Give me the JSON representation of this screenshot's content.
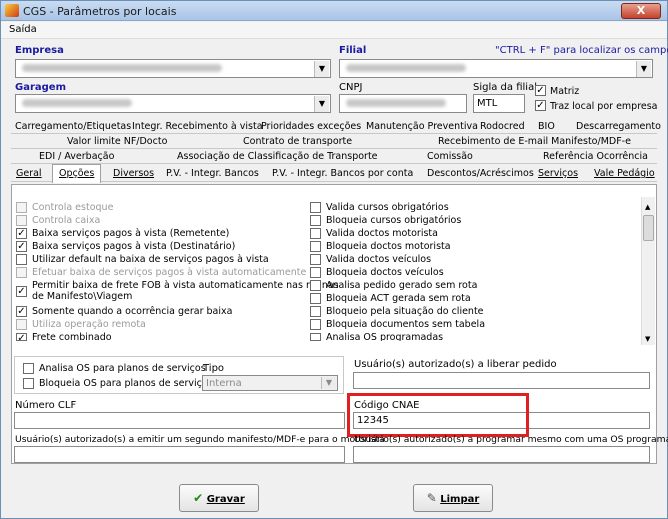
{
  "window": {
    "title": "CGS - Parâmetros por locais",
    "close_label": "X"
  },
  "menu": {
    "saida": "Saída"
  },
  "form": {
    "empresa_label": "Empresa",
    "filial_label": "Filial",
    "hint": "\"CTRL + F\" para localizar os campos",
    "garagem_label": "Garagem",
    "cnpj_label": "CNPJ",
    "sigla_label": "Sigla da filial",
    "sigla_value": "MTL",
    "matriz_label": "Matriz",
    "traz_local_label": "Traz local por empresa"
  },
  "tabs": {
    "row1": [
      "Carregamento/Etiquetas",
      "Integr. Recebimento à vista",
      "Prioridades exceções",
      "Manutenção Preventiva",
      "Rodocred",
      "BIO",
      "Descarregamento"
    ],
    "row2": [
      "Valor limite NF/Docto",
      "Contrato de transporte",
      "Recebimento de E-mail Manifesto/MDF-e"
    ],
    "row3": [
      "EDI / Averbação",
      "Associação de Classificação de Transporte",
      "Comissão",
      "Referência Ocorrência"
    ],
    "row4": [
      "Geral",
      "Opções",
      "Diversos",
      "P.V. - Integr. Bancos",
      "P.V. - Integr. Bancos por conta",
      "Descontos/Acréscimos",
      "Serviços",
      "Vale Pedágio"
    ]
  },
  "options_left": [
    "Controla estoque",
    "Controla caixa",
    "Baixa serviços pagos à vista (Remetente)",
    "Baixa serviços pagos à vista (Destinatário)",
    "Utilizar default na baixa de serviços pagos à vista",
    "Efetuar baixa de serviços pagos à vista automaticamente",
    "Permitir baixa de frete FOB à vista automaticamente nas rotinas",
    "de Manifesto\\Viagem",
    "Somente quando a ocorrência gerar baixa",
    "Utiliza operação remota",
    "Frete combinado"
  ],
  "options_right": [
    "Valida cursos obrigatórios",
    "Bloqueia cursos obrigatórios",
    "Valida doctos motorista",
    "Bloqueia doctos motorista",
    "Valida doctos veículos",
    "Bloqueia doctos veículos",
    "Analisa pedido gerado sem rota",
    "Bloqueia ACT gerada sem rota",
    "Bloqueio pela situação do cliente",
    "Bloqueia documentos sem tabela",
    "Analisa OS programadas"
  ],
  "os": {
    "analisa": "Analisa OS para planos de serviços",
    "bloqueia": "Bloqueia OS para planos de serviços",
    "tipo_label": "Tipo",
    "tipo_value": "Interna"
  },
  "fields": {
    "usuario_liberar": "Usuário(s) autorizado(s) a liberar pedido",
    "numero_clf": "Número CLF",
    "codigo_cnae": "Código CNAE",
    "cnae_value": "12345",
    "usuario_manifesto": "Usuário(s) autorizado(s) a emitir um segundo manifesto/MDF-e para o motorista",
    "usuario_programar": "Usuário(s) autorizado(s) a programar mesmo com uma OS programada"
  },
  "buttons": {
    "gravar": "Gravar",
    "limpar": "Limpar"
  }
}
